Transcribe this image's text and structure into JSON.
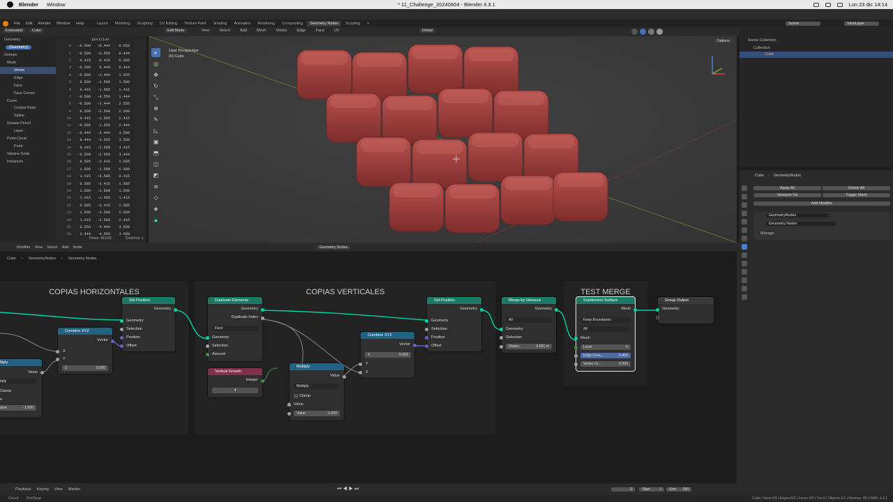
{
  "mac_menu": {
    "app": "Blender",
    "window": "Window",
    "title": "* 11_Challenge_20240604 - Blender 4.3.1",
    "clock": "Lun 23 dic 14:14"
  },
  "menus": [
    "File",
    "Edit",
    "Render",
    "Window",
    "Help"
  ],
  "workspaces": [
    "Layout",
    "Modeling",
    "Sculpting",
    "UV Editing",
    "Texture Paint",
    "Shading",
    "Animation",
    "Rendering",
    "Compositing",
    "Geometry Nodes",
    "Scripting"
  ],
  "active_workspace": "Geometry Nodes",
  "scene": {
    "label": "Scene",
    "view_layer": "ViewLayer"
  },
  "spreadsheet": {
    "mode": "Evaluated",
    "object": "Cube",
    "column": "position",
    "rows_label": "Rows: 49,633",
    "columns_label": "Columns: 1",
    "tree": [
      {
        "label": "Geometry",
        "kind": "head"
      },
      {
        "label": "(Geometry)",
        "kind": "pill"
      },
      {
        "label": "Domain",
        "kind": "head"
      },
      {
        "label": "Mesh",
        "kind": "sub"
      },
      {
        "label": "Vertex",
        "kind": "hl"
      },
      {
        "label": "Edge",
        "kind": "item"
      },
      {
        "label": "Face",
        "kind": "item"
      },
      {
        "label": "Face Corner",
        "kind": "item"
      },
      {
        "label": "Curve",
        "kind": "sub"
      },
      {
        "label": "Control Point",
        "kind": "item"
      },
      {
        "label": "Spline",
        "kind": "item"
      },
      {
        "label": "Grease Pencil",
        "kind": "sub"
      },
      {
        "label": "Layer",
        "kind": "item"
      },
      {
        "label": "Point Cloud",
        "kind": "sub"
      },
      {
        "label": "Point",
        "kind": "item"
      },
      {
        "label": "Volume Grids",
        "kind": "sub"
      },
      {
        "label": "Instances",
        "kind": "sub"
      }
    ],
    "rows": [
      [
        "0",
        "-0.500",
        "-0.444",
        "0.556"
      ],
      [
        "1",
        "-0.500",
        "-0.556",
        "0.444"
      ],
      [
        "2",
        "0.415",
        "0.415",
        "0.585"
      ],
      [
        "3",
        "-0.500",
        "0.444",
        "0.444"
      ],
      [
        "4",
        "-0.500",
        "-1.444",
        "1.556"
      ],
      [
        "5",
        "0.500",
        "-1.500",
        "1.500"
      ],
      [
        "6",
        "0.415",
        "-1.585",
        "1.415"
      ],
      [
        "7",
        "-0.500",
        "-0.556",
        "1.444"
      ],
      [
        "8",
        "-0.500",
        "-2.444",
        "2.556"
      ],
      [
        "9",
        "0.500",
        "-2.500",
        "2.500"
      ],
      [
        "10",
        "0.415",
        "-1.585",
        "2.415"
      ],
      [
        "11",
        "-0.500",
        "-1.556",
        "2.444"
      ],
      [
        "12",
        "-0.444",
        "-3.444",
        "3.500"
      ],
      [
        "13",
        "0.444",
        "-3.556",
        "3.500"
      ],
      [
        "14",
        "0.415",
        "-2.585",
        "3.415"
      ],
      [
        "15",
        "-0.500",
        "-2.556",
        "3.444"
      ],
      [
        "16",
        "0.585",
        "-1.415",
        "1.585"
      ],
      [
        "17",
        "1.500",
        "-1.500",
        "0.500"
      ],
      [
        "18",
        "1.415",
        "-0.585",
        "0.415"
      ],
      [
        "19",
        "0.585",
        "-2.415",
        "1.585"
      ],
      [
        "20",
        "1.500",
        "-2.500",
        "1.500"
      ],
      [
        "21",
        "1.415",
        "-1.585",
        "1.415"
      ],
      [
        "22",
        "0.585",
        "-3.415",
        "2.585"
      ],
      [
        "23",
        "1.500",
        "-3.500",
        "2.500"
      ],
      [
        "24",
        "1.415",
        "-2.585",
        "2.415"
      ],
      [
        "25",
        "0.556",
        "-4.444",
        "3.500"
      ],
      [
        "26",
        "1.444",
        "-4.556",
        "3.500"
      ]
    ]
  },
  "viewport": {
    "mode": "Edit Mode",
    "menus": [
      "View",
      "Select",
      "Add",
      "Mesh",
      "Vertex",
      "Edge",
      "Face",
      "UV"
    ],
    "transform": "Global",
    "overlay_title": "User Perspective",
    "overlay_sub": "(0) Cube",
    "options": "Options"
  },
  "outliner": {
    "collection_root": "Scene Collection",
    "collection": "Collection",
    "object": "Cube"
  },
  "properties": {
    "object": "Cube",
    "modifier_tree": "GeometryNodes",
    "apply_all": "Apply All",
    "delete_all": "Delete All",
    "viewport_vis": "Viewport Vis",
    "toggle_stack": "Toggle Stack",
    "add_modifier": "Add Modifier",
    "modifier_name": "GeometryNodes",
    "node_group": "Geometry Nodes",
    "manage": "Manage"
  },
  "node_editor": {
    "menus": [
      "Modifier",
      "View",
      "Select",
      "Add",
      "Node"
    ],
    "group_name": "Geometry Nodes",
    "breadcrumb": [
      "Cube",
      "GeometryNodes",
      "Geometry Nodes"
    ],
    "frames": {
      "h": "COPIAS HORIZONTALES",
      "v": "COPIAS VERTICALES",
      "m": "TEST MERGE"
    },
    "nodes": {
      "multiply_left": {
        "title": "ltiply",
        "value": "Value",
        "mode": "tiply",
        "clamp": "Clamp",
        "input_label": "alue",
        "input_val": "-1.000",
        "e": "e"
      },
      "combine1": {
        "title": "Combine XYZ",
        "vector": "Vector",
        "x": "X",
        "y": "Y",
        "z": "Z",
        "z_val": "0.000"
      },
      "setpos1": {
        "title": "Set Position",
        "geometry": "Geometry",
        "selection": "Selection",
        "position": "Position",
        "offset": "Offset"
      },
      "duplicate": {
        "title": "Duplicate Elements",
        "geometry": "Geometry",
        "dup_index": "Duplicate Index",
        "domain": "Face",
        "selection": "Selection",
        "amount": "Amount"
      },
      "vgrowth": {
        "title": "Vertical Growth",
        "integer": "Integer",
        "value": "4"
      },
      "multiply2": {
        "title": "Multiply",
        "value": "Value",
        "mode": "Multiply",
        "clamp": "Clamp",
        "input": "Value",
        "input_label": "Value",
        "input_val": "-1.000"
      },
      "combine2": {
        "title": "Combine XYZ",
        "vector": "Vector",
        "x": "X",
        "x_val": "0.000",
        "y": "Y",
        "z": "Z"
      },
      "setpos2": {
        "title": "Set Position",
        "geometry": "Geometry",
        "selection": "Selection",
        "position": "Position",
        "offset": "Offset"
      },
      "merge": {
        "title": "Merge by Distance",
        "geometry": "Geometry",
        "mode": "All",
        "selection": "Selection",
        "distance_label": "Distan...",
        "distance": "0.001 m"
      },
      "subdiv": {
        "title": "Subdivision Surface",
        "mesh": "Mesh",
        "boundary": "Keep Boundaries",
        "uv": "All",
        "level_label": "Level",
        "level": "5",
        "crease_label": "Edge Crea...",
        "crease": "0.404",
        "vcrease_label": "Vertex Cr...",
        "vcrease": "0.000"
      },
      "output": {
        "title": "Group Output",
        "geometry": "Geometry"
      }
    }
  },
  "timeline": {
    "menus": [
      "Playback",
      "Keying",
      "View",
      "Marker"
    ],
    "frame": "0",
    "start_label": "Start",
    "start": "1",
    "end_label": "End",
    "end": "250"
  },
  "status": {
    "left": "Circuit",
    "left2": "Rot/Snap",
    "right": "Cube | Verts:0/0 | Edges:0/0 | Faces:0/0 | Tris:0 | Objects:1/1 | Memory: 85.3 MiB | 4.3.1"
  },
  "colors": {
    "cube_red": "#9b3a37",
    "geometry_socket": "#00d6a3",
    "node_header_green": "#1d7a66",
    "node_header_blue": "#246283"
  }
}
